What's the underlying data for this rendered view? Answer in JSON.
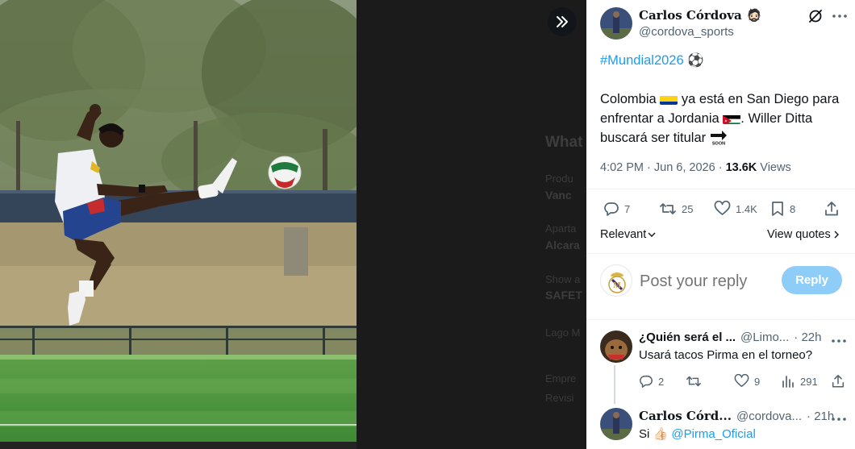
{
  "viewer": {
    "expand_icon": "double-chevron-right-icon",
    "background_page": {
      "heading": "What",
      "rows": [
        {
          "label": "Produ",
          "value": "Vanc"
        },
        {
          "label": "Aparta",
          "value": "Alcara"
        },
        {
          "label": "Show a",
          "value": "SAFET"
        },
        {
          "label": "Lago M",
          "value": ""
        },
        {
          "label": "Empre",
          "value": ""
        },
        {
          "label": "Revisi",
          "value": ""
        }
      ]
    }
  },
  "tweet": {
    "author_name": "Carlos Córdova",
    "author_emoji": "🧔🏻",
    "author_handle": "@cordova_sports",
    "grok_icon": "grok-icon",
    "hashtag": "#Mundial2026",
    "hashtag_emoji": "⚽",
    "body_part1": "Colombia",
    "body_part2": "ya está en San Diego para enfrentar a Jordania",
    "body_part3": ". Willer Ditta buscará ser titular",
    "timestamp": "4:02 PM · Jun 6, 2026 · ",
    "views_count": "13.6K",
    "views_label": "Views",
    "stats": {
      "replies": "7",
      "retweets": "25",
      "likes": "1.4K",
      "bookmarks": "8"
    },
    "sort_label": "Relevant",
    "view_quotes_label": "View quotes"
  },
  "reply_box": {
    "placeholder": "Post your reply",
    "button_label": "Reply"
  },
  "replies": [
    {
      "name": "¿Quién será el ...",
      "handle": "@Limo...",
      "time": "· 22h",
      "text": "Usará tacos Pirma en el torneo?",
      "stats": {
        "replies": "2",
        "retweets": "",
        "likes": "9",
        "views": "291"
      }
    },
    {
      "name": "Carlos Córd...",
      "handle": "@cordova...",
      "time": "· 21h",
      "text_prefix": "Si 👍🏻 ",
      "mention": "@Pirma_Oficial"
    }
  ],
  "colors": {
    "accent": "#1d9bf0",
    "text": "#0f1419",
    "muted": "#536471",
    "reply_button": "#8ecdf7"
  }
}
